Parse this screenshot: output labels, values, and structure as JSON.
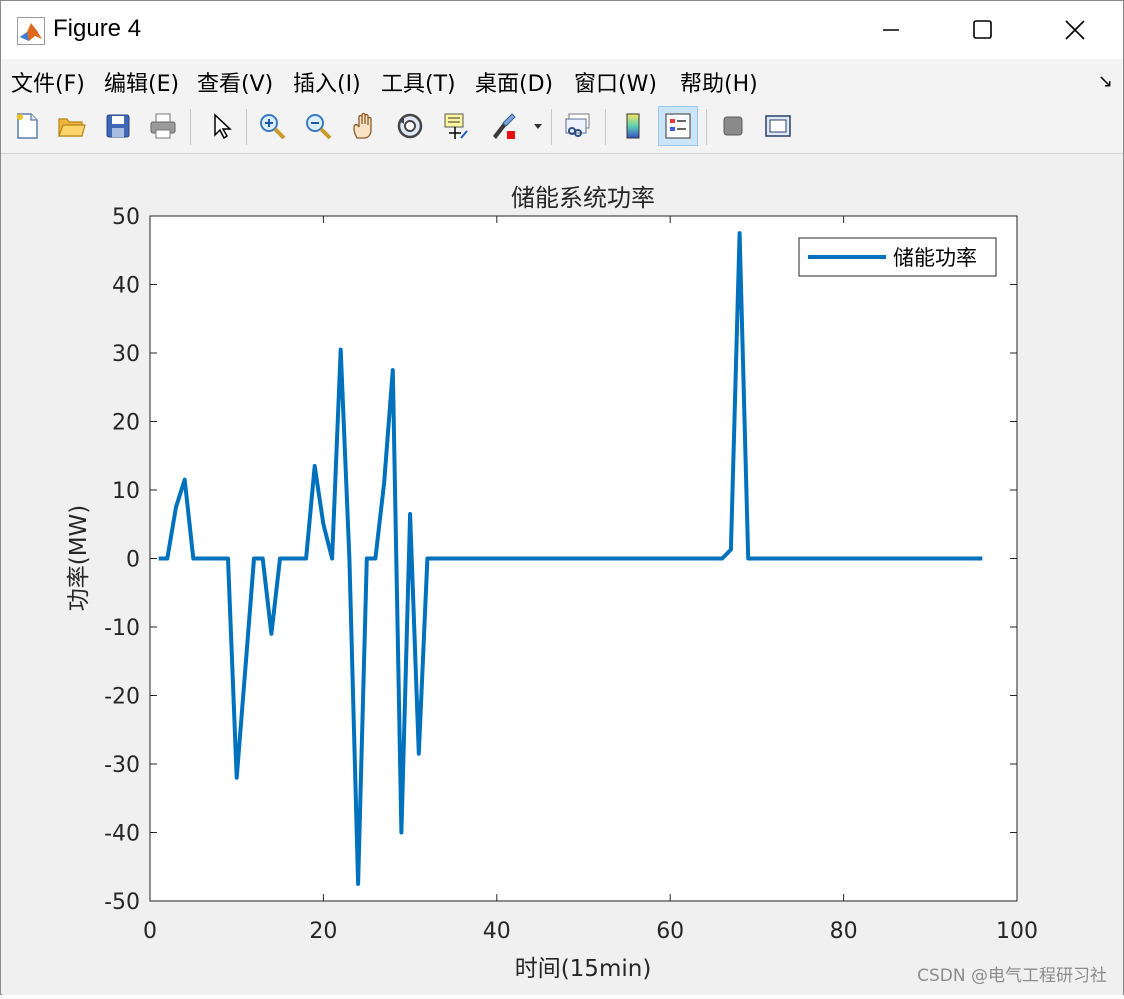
{
  "window": {
    "title": "Figure 4"
  },
  "menu": [
    {
      "label": "文件(F)"
    },
    {
      "label": "编辑(E)"
    },
    {
      "label": "查看(V)"
    },
    {
      "label": "插入(I)"
    },
    {
      "label": "工具(T)"
    },
    {
      "label": "桌面(D)"
    },
    {
      "label": "窗口(W)"
    },
    {
      "label": "帮助(H)"
    }
  ],
  "toolbar": {
    "icons": [
      "new-file-icon",
      "open-folder-icon",
      "save-icon",
      "print-icon",
      "pointer-icon",
      "zoom-in-icon",
      "zoom-out-icon",
      "pan-hand-icon",
      "rotate-3d-icon",
      "data-cursor-icon",
      "brush-icon",
      "link-icon",
      "colorbar-icon",
      "legend-icon",
      "hide-plot-tools-icon",
      "show-plot-tools-icon"
    ],
    "active": "legend-icon"
  },
  "chart_data": {
    "type": "line",
    "title": "储能系统功率",
    "xlabel": "时间(15min)",
    "ylabel": "功率(MW)",
    "xlim": [
      0,
      100
    ],
    "ylim": [
      -50,
      50
    ],
    "xticks": [
      0,
      20,
      40,
      60,
      80,
      100
    ],
    "yticks": [
      -50,
      -40,
      -30,
      -20,
      -10,
      0,
      10,
      20,
      30,
      40,
      50
    ],
    "grid": false,
    "legend_position": "top-right",
    "series": [
      {
        "name": "储能功率",
        "color": "#0072BD",
        "x": [
          1,
          2,
          3,
          4,
          5,
          6,
          7,
          8,
          9,
          10,
          11,
          12,
          13,
          14,
          15,
          16,
          17,
          18,
          19,
          20,
          21,
          22,
          23,
          24,
          25,
          26,
          27,
          28,
          29,
          30,
          31,
          32,
          33,
          40,
          50,
          60,
          66,
          67,
          68,
          69,
          70,
          80,
          90,
          96
        ],
        "y": [
          0,
          0,
          7.5,
          11.5,
          0,
          0,
          0,
          0,
          0,
          -32,
          -16,
          0,
          0,
          -11,
          0,
          0,
          0,
          0,
          13.5,
          5,
          0,
          30.5,
          0,
          -47.5,
          0,
          0,
          11,
          27.5,
          -40,
          6.5,
          -28.5,
          0,
          0,
          0,
          0,
          0,
          0,
          1.3,
          47.5,
          0,
          0,
          0,
          0,
          0
        ]
      }
    ]
  },
  "watermark": "CSDN @电气工程研习社"
}
